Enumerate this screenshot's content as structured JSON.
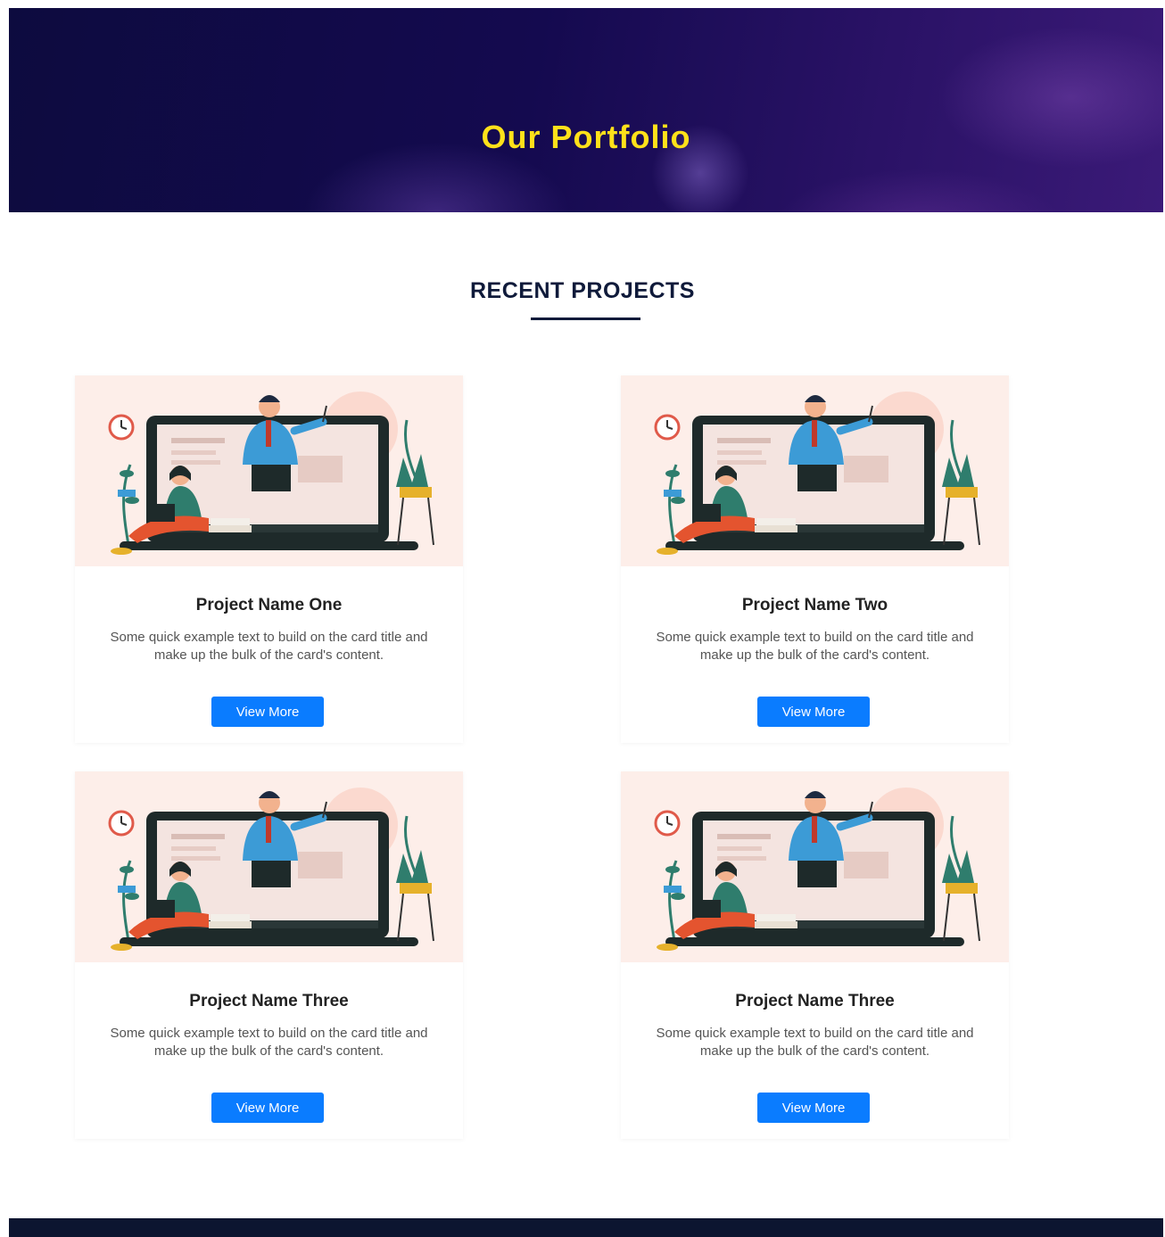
{
  "hero": {
    "title": "Our Portfolio"
  },
  "section": {
    "title": "RECENT PROJECTS"
  },
  "projects": [
    {
      "title": "Project Name One",
      "text": "Some quick example text to build on the card title and make up the bulk of the card's content.",
      "button": "View More"
    },
    {
      "title": "Project Name Two",
      "text": "Some quick example text to build on the card title and make up the bulk of the card's content.",
      "button": "View More"
    },
    {
      "title": "Project Name Three",
      "text": "Some quick example text to build on the card title and make up the bulk of the card's content.",
      "button": "View More"
    },
    {
      "title": "Project Name Three",
      "text": "Some quick example text to build on the card title and make up the bulk of the card's content.",
      "button": "View More"
    }
  ],
  "colors": {
    "hero_title": "#ffe11a",
    "button": "#0a7cff",
    "heading": "#0f1a3a",
    "footer": "#0c1530"
  }
}
